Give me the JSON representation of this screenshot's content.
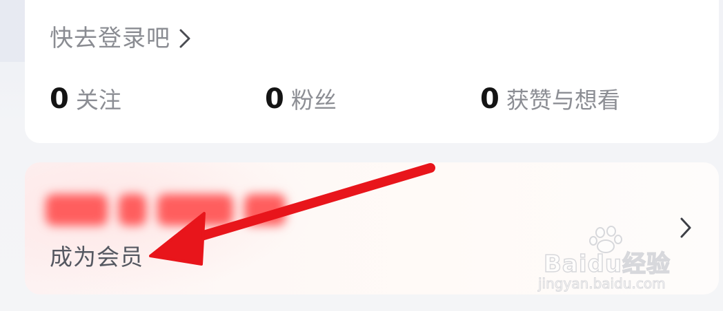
{
  "profile": {
    "login_prompt": "快去登录吧",
    "stats": [
      {
        "value": "0",
        "label": "关注"
      },
      {
        "value": "0",
        "label": "粉丝"
      },
      {
        "value": "0",
        "label": "获赞与想看"
      }
    ]
  },
  "vip": {
    "subtitle": "成为会员"
  },
  "watermark": {
    "brand": "Baidu经验",
    "url": "jingyan.baidu.com"
  },
  "icons": {
    "login_chevron": "chevron-right-icon",
    "vip_chevron": "chevron-right-icon",
    "annotation": "red-arrow-icon",
    "watermark_logo": "baidu-paw-icon"
  },
  "colors": {
    "arrow": "#e8151b",
    "vip_blurred_text": "#ff5e5e",
    "muted_text": "#8a8c92",
    "number_text": "#141414"
  }
}
